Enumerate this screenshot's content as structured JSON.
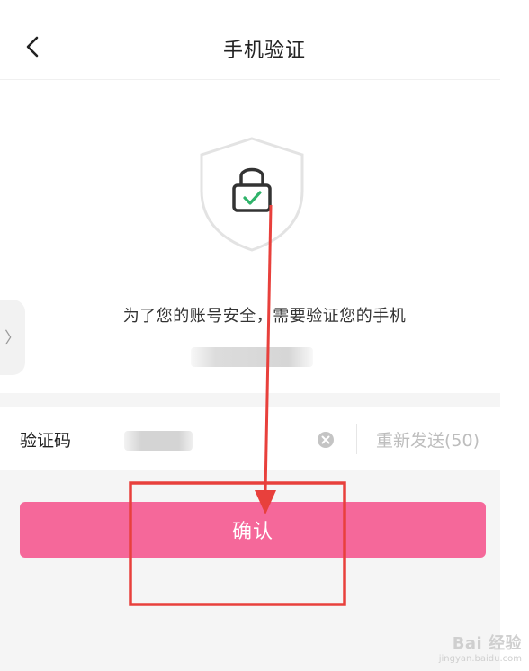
{
  "header": {
    "title": "手机验证"
  },
  "main": {
    "description": "为了您的账号安全，需要验证您的手机"
  },
  "code_row": {
    "label": "验证码",
    "value": "",
    "resend_label": "重新发送(50)"
  },
  "confirm_label": "确认",
  "colors": {
    "accent": "#f5689a",
    "annotation": "#e8403c",
    "check": "#2fb36a"
  },
  "icons": {
    "back": "chevron-left-icon",
    "shield": "shield-lock-icon",
    "clear": "clear-circle-icon",
    "side_tab": "chevron-right-icon"
  },
  "watermark": {
    "main": "Bai 经验",
    "sub": "jingyan.baidu.com"
  }
}
